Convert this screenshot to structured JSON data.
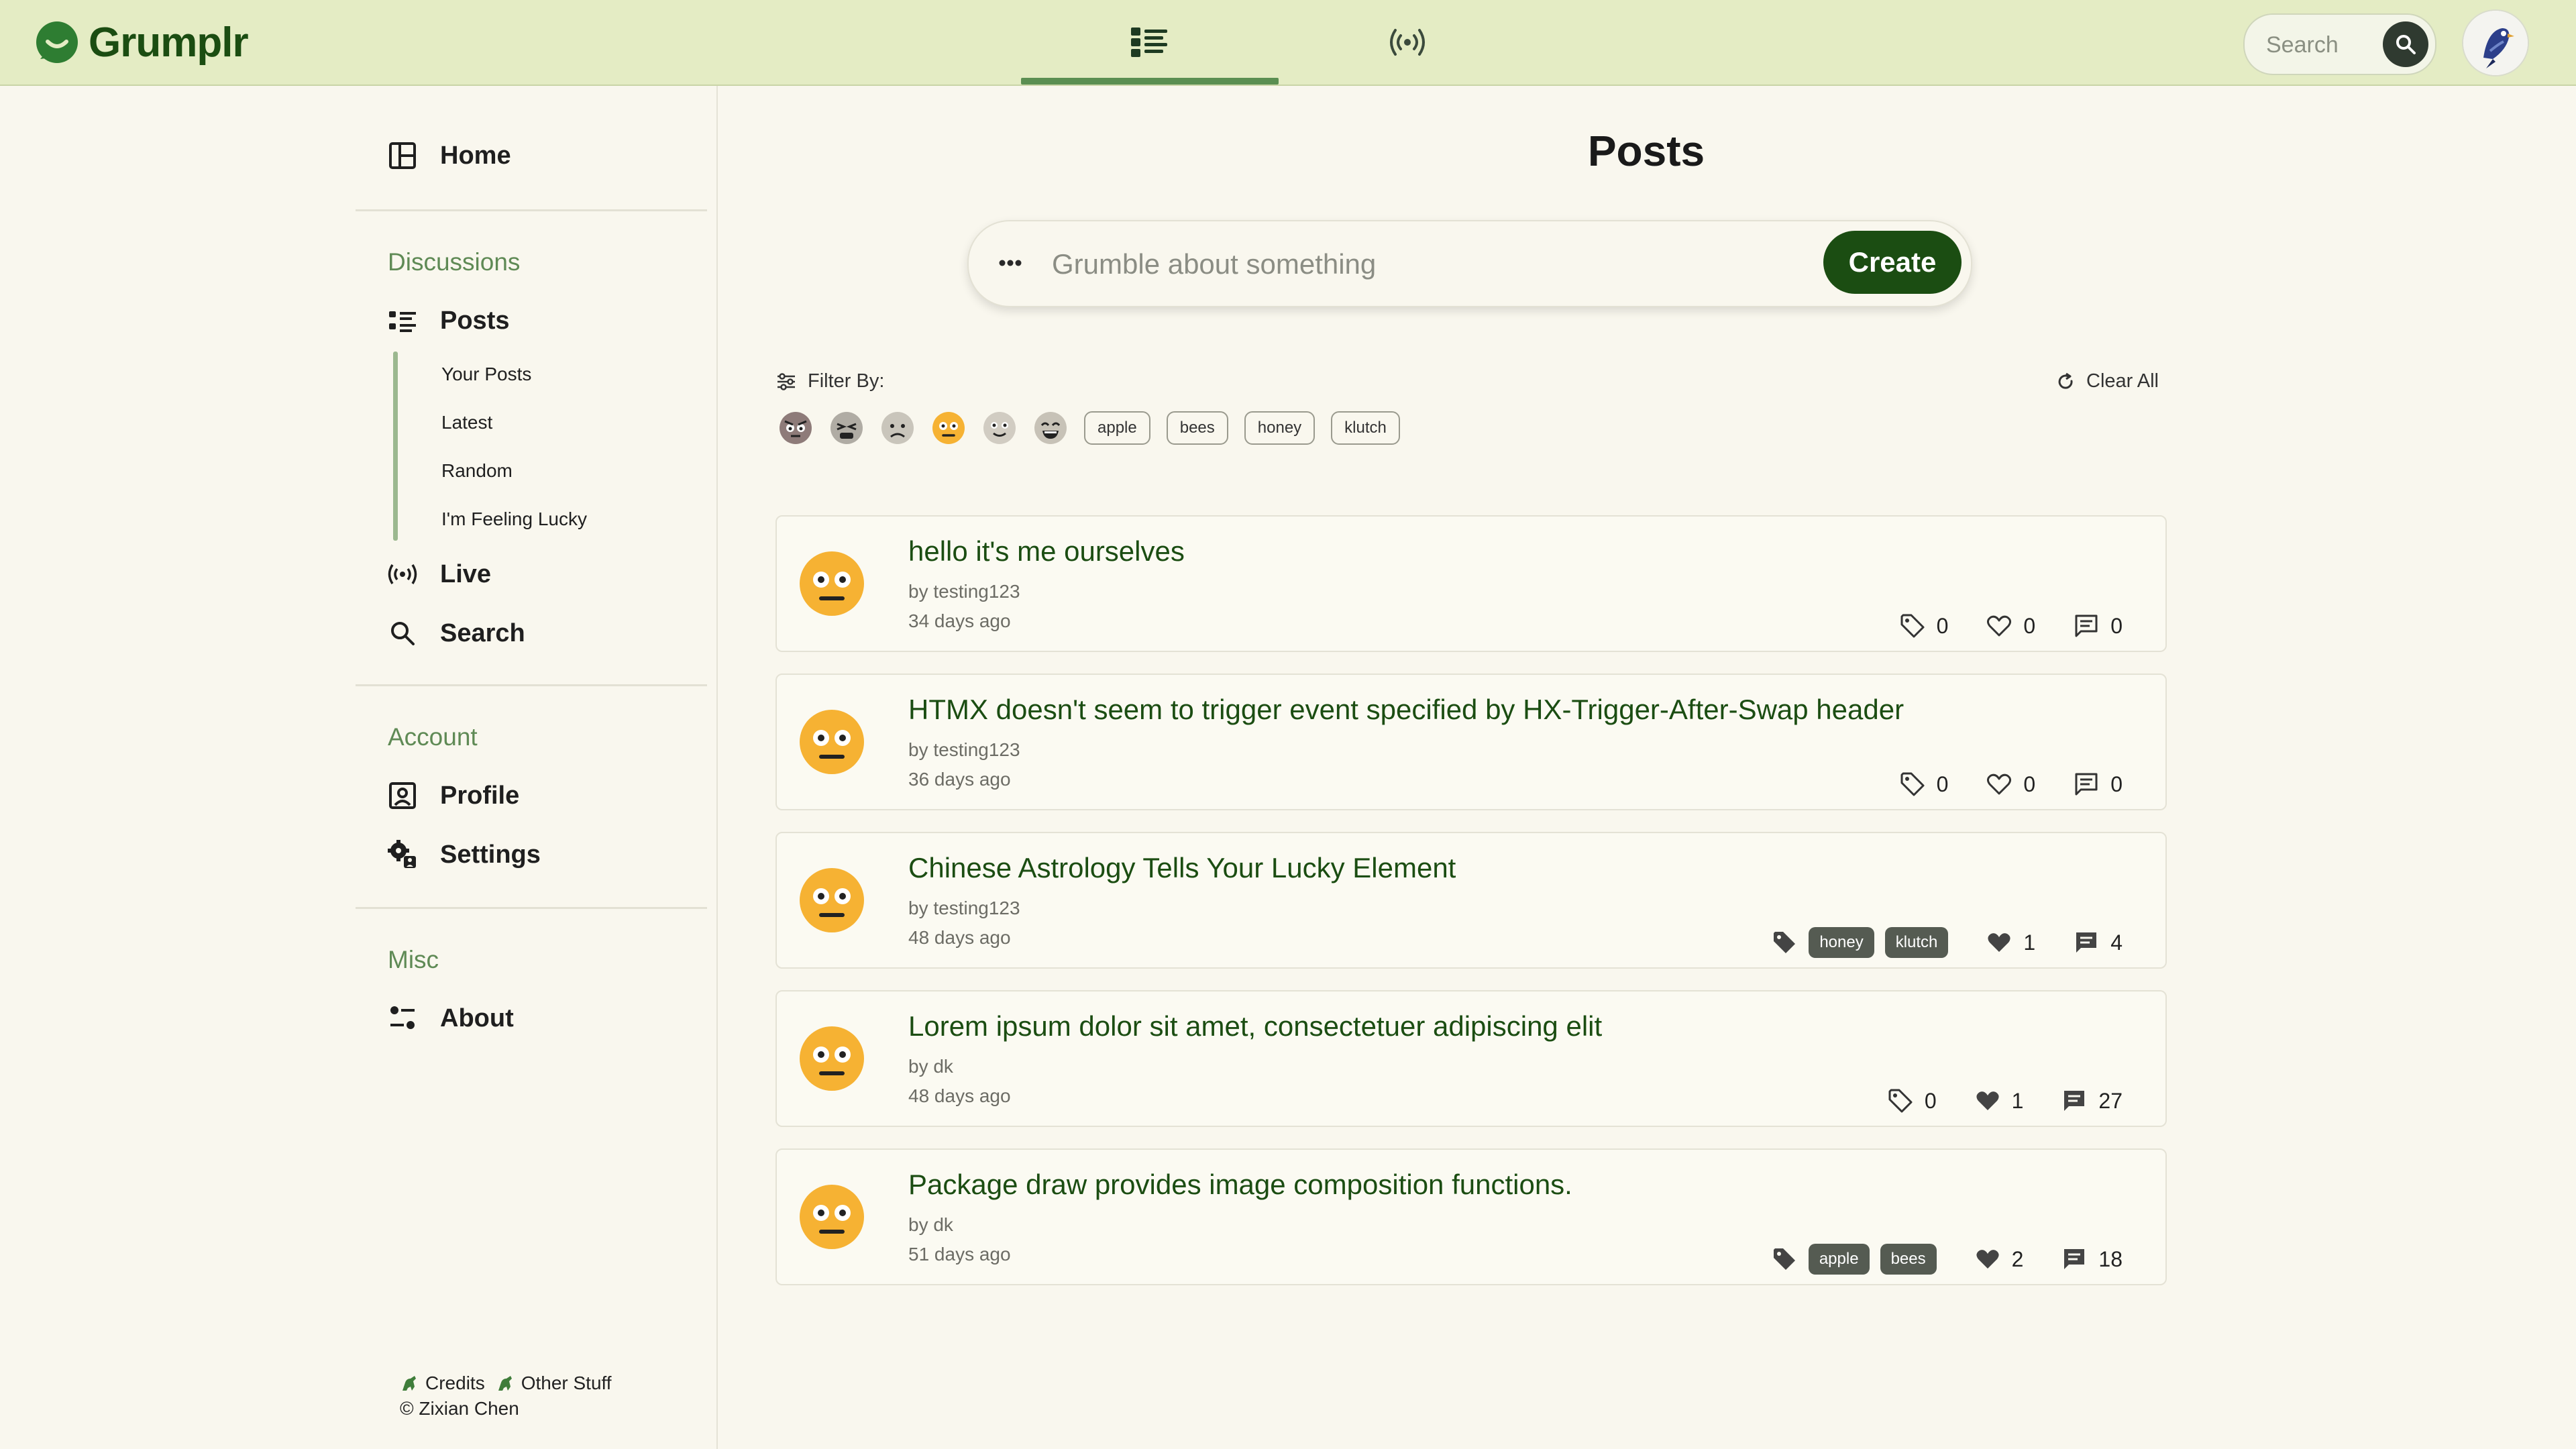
{
  "app": {
    "name": "Grumplr"
  },
  "header": {
    "tabs": [
      {
        "name": "posts-tab",
        "icon": "posts-list-icon",
        "active": true
      },
      {
        "name": "live-tab",
        "icon": "broadcast-icon",
        "active": false
      }
    ],
    "search": {
      "placeholder": "Search"
    },
    "avatar": {
      "icon": "bird-avatar-icon"
    }
  },
  "sidebar": {
    "home_label": "Home",
    "discussions": {
      "heading": "Discussions",
      "posts_label": "Posts",
      "sub_items": [
        "Your Posts",
        "Latest",
        "Random",
        "I'm Feeling Lucky"
      ],
      "live_label": "Live",
      "search_label": "Search"
    },
    "account": {
      "heading": "Account",
      "profile_label": "Profile",
      "settings_label": "Settings"
    },
    "misc": {
      "heading": "Misc",
      "about_label": "About"
    },
    "footer": {
      "credits": "Credits",
      "other": "Other Stuff",
      "copyright": "© Zixian Chen"
    }
  },
  "main": {
    "title": "Posts",
    "composer": {
      "placeholder": "Grumble about something",
      "create_label": "Create"
    },
    "filter": {
      "label": "Filter By:",
      "clear_label": "Clear All",
      "faces": [
        "angry-face-icon",
        "tired-face-icon",
        "frowning-face-icon",
        "neutral-face-icon",
        "slight-smile-face-icon",
        "grinning-face-icon"
      ],
      "tags": [
        "apple",
        "bees",
        "honey",
        "klutch"
      ]
    },
    "posts": [
      {
        "title": "hello it's me ourselves",
        "author": "by testing123",
        "age": "34 days ago",
        "tags": [],
        "tag_count": "0",
        "likes": "0",
        "comments": "0"
      },
      {
        "title": "HTMX doesn't seem to trigger event specified by HX-Trigger-After-Swap header",
        "author": "by testing123",
        "age": "36 days ago",
        "tags": [],
        "tag_count": "0",
        "likes": "0",
        "comments": "0"
      },
      {
        "title": "Chinese Astrology Tells Your Lucky Element",
        "author": "by testing123",
        "age": "48 days ago",
        "tags": [
          "honey",
          "klutch"
        ],
        "likes": "1",
        "comments": "4"
      },
      {
        "title": "Lorem ipsum dolor sit amet, consectetuer adipiscing elit",
        "author": "by dk",
        "age": "48 days ago",
        "tags": [],
        "tag_count": "0",
        "likes": "1",
        "comments": "27"
      },
      {
        "title": "Package draw provides image composition functions.",
        "author": "by dk",
        "age": "51 days ago",
        "tags": [
          "apple",
          "bees"
        ],
        "likes": "2",
        "comments": "18"
      }
    ]
  },
  "colors": {
    "brand": "#1b4d12",
    "header_bg": "#e4ecc4",
    "accent_green": "#5f8a55",
    "page_bg": "#f9f7ee",
    "face_yellow": "#f6b233"
  }
}
